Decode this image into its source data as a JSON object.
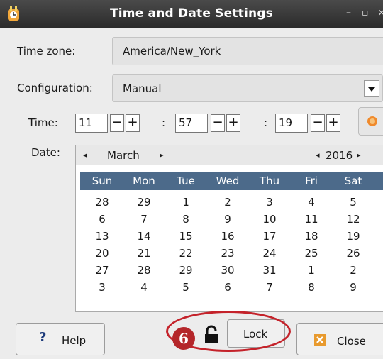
{
  "window": {
    "title": "Time and Date Settings",
    "minimize_glyph": "–",
    "restore_glyph": "▫",
    "close_glyph": "×"
  },
  "timezone": {
    "label": "Time zone:",
    "value": "America/New_York"
  },
  "configuration": {
    "label": "Configuration:",
    "value": "Manual"
  },
  "time": {
    "label": "Time:",
    "hours": "11",
    "minutes": "57",
    "seconds": "19",
    "minus": "−",
    "plus": "+",
    "separator": ":"
  },
  "date": {
    "label": "Date:",
    "month": "March",
    "year": "2016",
    "prev_glyph": "◂",
    "next_glyph": "▸",
    "weekdays": [
      "Sun",
      "Mon",
      "Tue",
      "Wed",
      "Thu",
      "Fri",
      "Sat"
    ],
    "weeks": [
      [
        "28",
        "29",
        "1",
        "2",
        "3",
        "4",
        "5"
      ],
      [
        "6",
        "7",
        "8",
        "9",
        "10",
        "11",
        "12"
      ],
      [
        "13",
        "14",
        "15",
        "16",
        "17",
        "18",
        "19"
      ],
      [
        "20",
        "21",
        "22",
        "23",
        "24",
        "25",
        "26"
      ],
      [
        "27",
        "28",
        "29",
        "30",
        "31",
        "1",
        "2"
      ],
      [
        "3",
        "4",
        "5",
        "6",
        "7",
        "8",
        "9"
      ]
    ]
  },
  "buttons": {
    "help": "Help",
    "help_glyph": "?",
    "lock": "Lock",
    "close": "Close"
  },
  "annotation": {
    "step": "6"
  },
  "colors": {
    "accent": "#4c6a8a",
    "callout": "#b4262a"
  },
  "icons": {
    "app": "app-icon",
    "now": "now-icon",
    "lock": "lock-icon",
    "close": "close-icon"
  }
}
